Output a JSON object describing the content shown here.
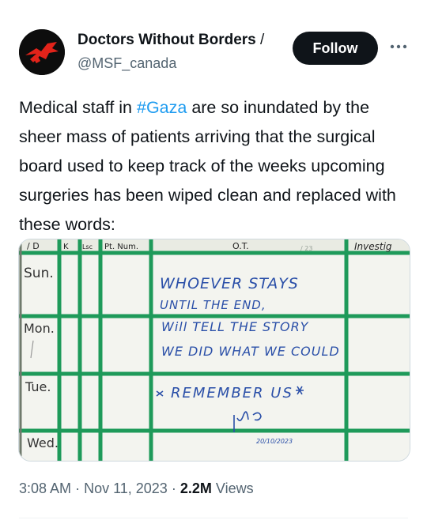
{
  "author": {
    "name": "Doctors Without Borders",
    "name_truncation": "/",
    "handle": "@MSF_canada"
  },
  "follow_label": "Follow",
  "tweet": {
    "text_before": "Medical staff in ",
    "hashtag": "#Gaza",
    "text_after": " are so inundated by the sheer mass of patients arriving that the surgical board used to keep track of the weeks upcoming surgeries has been wiped clean and replaced with these words:"
  },
  "board": {
    "headers": [
      "/ D",
      "K",
      "Lsc",
      "Pt. Num.",
      "O.T.",
      "/ 23",
      "Investig"
    ],
    "days": [
      "Sun.",
      "Mon.",
      "Tue.",
      "Wed."
    ],
    "message": [
      "WHOEVER STAYS",
      "UNTIL THE END,",
      "Will TELL THE STORY",
      "WE DID WHAT WE COULD",
      "REMEMBER US"
    ],
    "date": "20/10/2023"
  },
  "meta": {
    "time": "3:08 AM",
    "sep1": "·",
    "date": "Nov 11, 2023",
    "sep2": "·",
    "views_count": "2.2M",
    "views_label": "Views"
  },
  "colors": {
    "link": "#1d9bf0",
    "follow_bg": "#0f1419",
    "secondary_text": "#536471",
    "board_lines": "#1e9a5a",
    "marker_ink": "#2a4fa8"
  }
}
